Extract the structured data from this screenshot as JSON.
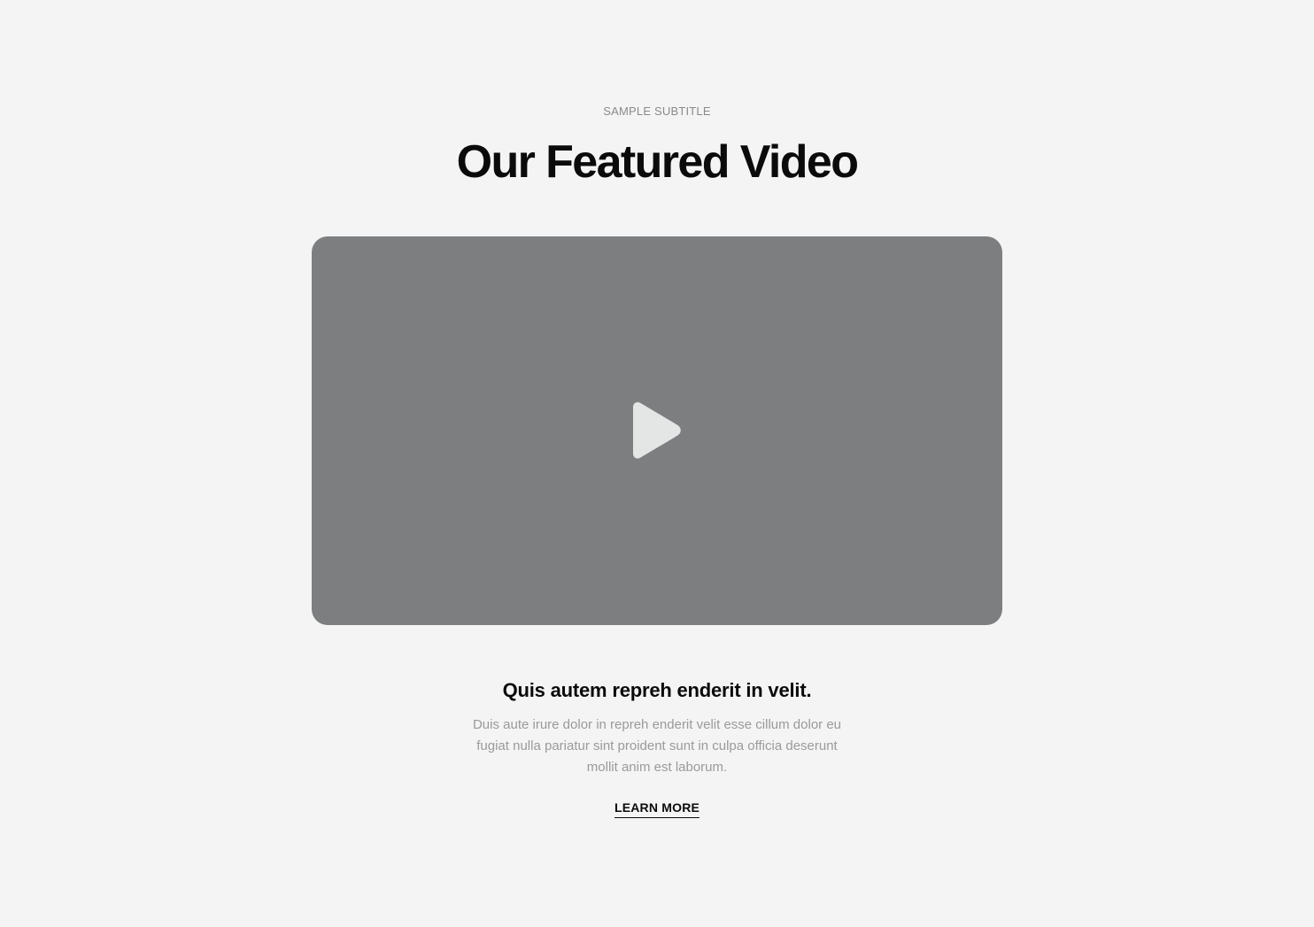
{
  "header": {
    "subtitle": "SAMPLE SUBTITLE",
    "title": "Our Featured Video"
  },
  "video": {
    "play_icon": "play-icon",
    "placeholder_color": "#7d7e80",
    "icon_color": "#e4e5e5"
  },
  "caption": {
    "title": "Quis autem repreh enderit in velit.",
    "text": "Duis aute irure dolor in repreh enderit velit esse cillum dolor eu fugiat nulla pariatur sint proident sunt in culpa officia deserunt mollit anim est laborum."
  },
  "cta": {
    "label": "LEARN MORE"
  }
}
